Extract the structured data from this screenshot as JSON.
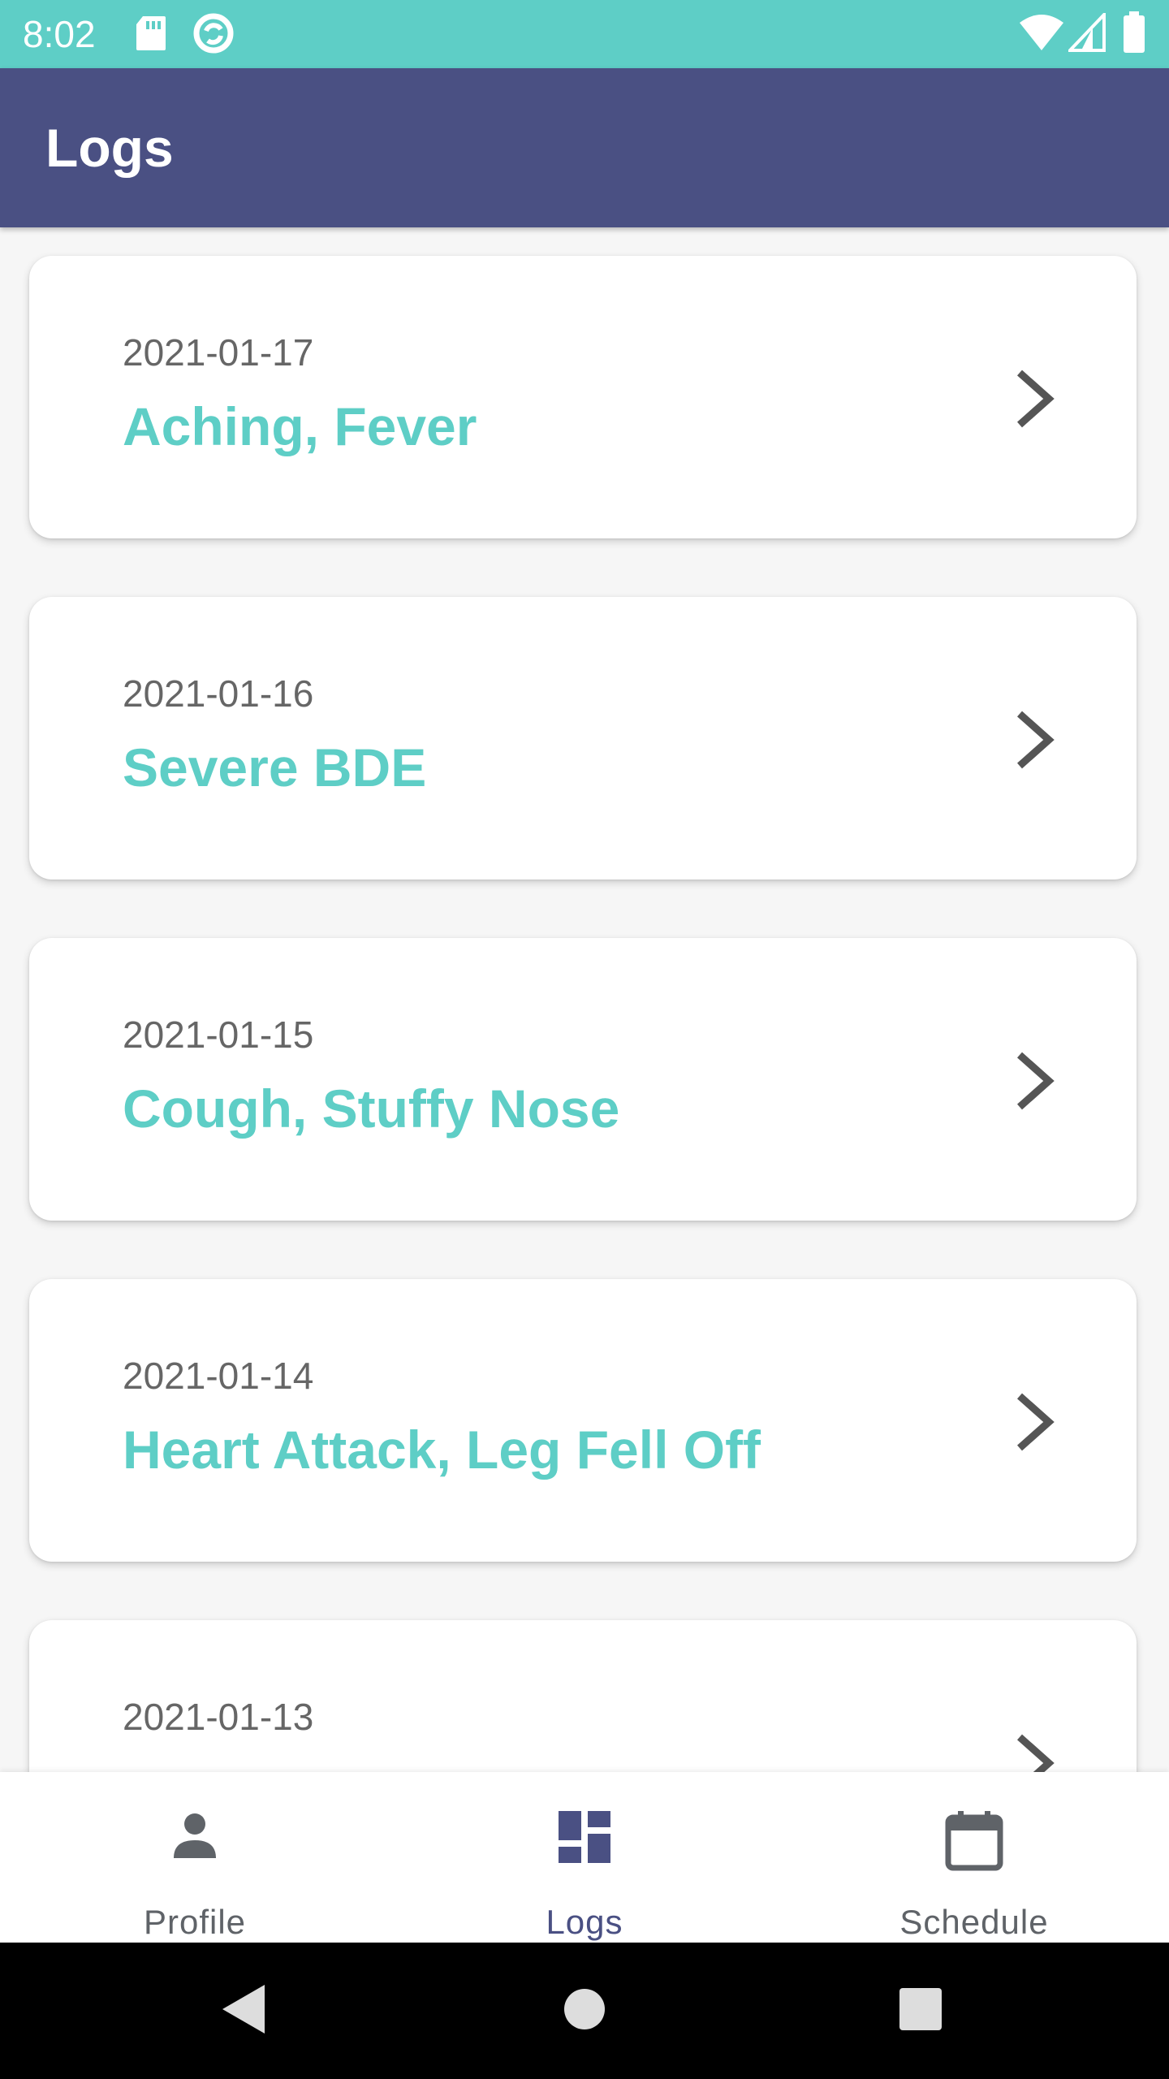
{
  "status_bar": {
    "time": "8:02",
    "icons": [
      "sd-card-icon",
      "sync-icon",
      "wifi-icon",
      "signal-icon",
      "battery-icon"
    ]
  },
  "app_bar": {
    "title": "Logs"
  },
  "logs": [
    {
      "date": "2021-01-17",
      "symptoms": "Aching, Fever"
    },
    {
      "date": "2021-01-16",
      "symptoms": "Severe BDE"
    },
    {
      "date": "2021-01-15",
      "symptoms": "Cough, Stuffy Nose"
    },
    {
      "date": "2021-01-14",
      "symptoms": "Heart Attack, Leg Fell Off"
    },
    {
      "date": "2021-01-13",
      "symptoms": ""
    }
  ],
  "bottom_nav": {
    "items": [
      {
        "label": "Profile",
        "icon": "person-icon",
        "active": false
      },
      {
        "label": "Logs",
        "icon": "dashboard-icon",
        "active": true
      },
      {
        "label": "Schedule",
        "icon": "calendar-icon",
        "active": false
      }
    ]
  },
  "colors": {
    "status_bar": "#5ecec6",
    "app_bar": "#4a5083",
    "accent": "#5ecec6",
    "nav_active": "#4a5083",
    "nav_inactive": "#5f6368"
  }
}
